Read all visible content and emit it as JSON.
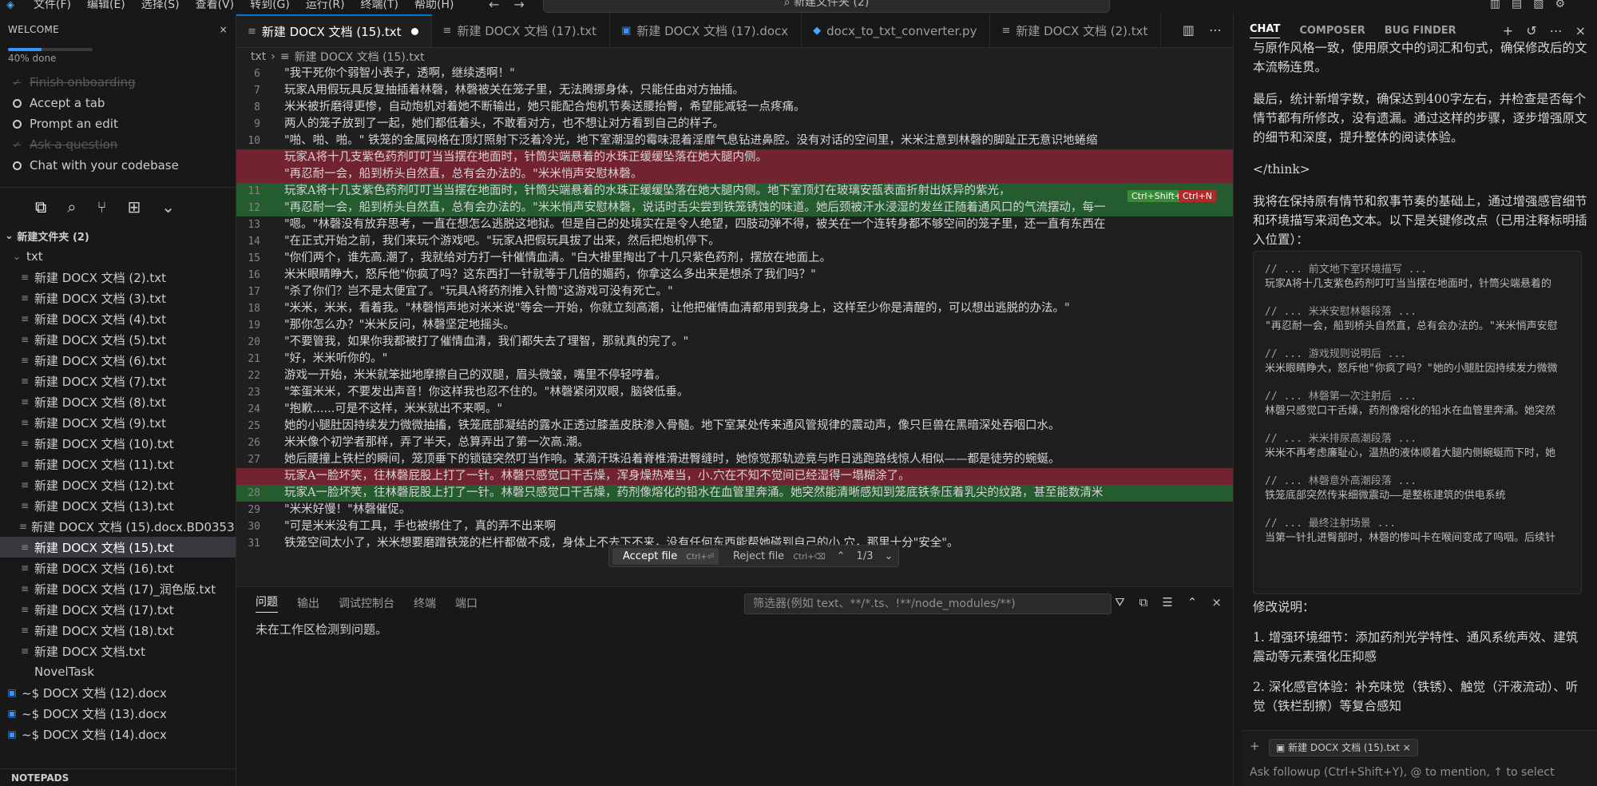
{
  "menu": [
    "文件(F)",
    "编辑(E)",
    "选择(S)",
    "查看(V)",
    "转到(G)",
    "运行(R)",
    "终端(T)",
    "帮助(H)"
  ],
  "command_center": "新建文件夹 (2)",
  "welcome": {
    "title": "WELCOME",
    "progress_text": "40% done",
    "progress": 0.4,
    "items": [
      {
        "label": "Finish onboarding",
        "done": true
      },
      {
        "label": "Accept a tab",
        "done": false
      },
      {
        "label": "Prompt an edit",
        "done": false
      },
      {
        "label": "Ask a question",
        "done": true
      },
      {
        "label": "Chat with your codebase",
        "done": false
      }
    ]
  },
  "explorer": {
    "root": "新建文件夹 (2)",
    "folder": "txt",
    "files": [
      "新建 DOCX 文档 (2).txt",
      "新建 DOCX 文档 (3).txt",
      "新建 DOCX 文档 (4).txt",
      "新建 DOCX 文档 (5).txt",
      "新建 DOCX 文档 (6).txt",
      "新建 DOCX 文档 (7).txt",
      "新建 DOCX 文档 (8).txt",
      "新建 DOCX 文档 (9).txt",
      "新建 DOCX 文档 (10).txt",
      "新建 DOCX 文档 (11).txt",
      "新建 DOCX 文档 (12).txt",
      "新建 DOCX 文档 (13).txt",
      "新建 DOCX 文档 (15).docx.BD0353E...",
      "新建 DOCX 文档 (15).txt",
      "新建 DOCX 文档 (16).txt",
      "新建 DOCX 文档 (17)_润色版.txt",
      "新建 DOCX 文档 (17).txt",
      "新建 DOCX 文档 (18).txt",
      "新建 DOCX 文档.txt",
      "NovelTask"
    ],
    "selected_index": 13,
    "docs": [
      "~$ DOCX 文档 (12).docx",
      "~$ DOCX 文档 (13).docx",
      "~$ DOCX 文档 (14).docx"
    ],
    "notepads": "NOTEPADS"
  },
  "tabs": [
    {
      "label": "新建 DOCX 文档 (15).txt",
      "active": true,
      "icon": "≡"
    },
    {
      "label": "新建 DOCX 文档 (17).txt",
      "active": false,
      "icon": "≡"
    },
    {
      "label": "新建 DOCX 文档 (17).docx",
      "active": false,
      "icon": "▣"
    },
    {
      "label": "docx_to_txt_converter.py",
      "active": false,
      "icon": "◆"
    },
    {
      "label": "新建 DOCX 文档 (2).txt",
      "active": false,
      "icon": "≡"
    }
  ],
  "breadcrumb": [
    "txt",
    "新建 DOCX 文档 (15).txt"
  ],
  "editor_lines": [
    {
      "n": "6",
      "t": "\"我干死你个弱智小表子，透啊，继续透啊！\"",
      "k": ""
    },
    {
      "n": "7",
      "t": "玩家A用假玩具反复抽插着林磬，林磬被关在笼子里，无法腾挪身体，只能任由对方抽插。",
      "k": ""
    },
    {
      "n": "8",
      "t": "米米被折磨得更惨，自动炮机对着她不断输出，她只能配合炮机节奏送腰抬臀，希望能减轻一点疼痛。",
      "k": ""
    },
    {
      "n": "9",
      "t": "两人的笼子放到了一起，她们都低着头，不敢看对方，也不想让对方看到自己的样子。",
      "k": ""
    },
    {
      "n": "10",
      "t": "\"啪、啪、啪。\" 铁笼的金属网格在顶灯照射下泛着冷光，地下室潮湿的霉味混着淫靡气息钻进鼻腔。没有对话的空间里，米米注意到林磬的脚趾正无意识地蜷缩",
      "k": ""
    },
    {
      "n": "",
      "t": "玩家A将十几支紫色药剂叮叮当当摆在地面时，针筒尖端悬着的水珠正缓缓坠落在她大腿内侧。",
      "k": "del"
    },
    {
      "n": "",
      "t": "\"再忍耐一会，船到桥头自然直，总有会办法的。\"米米悄声安慰林磬。",
      "k": "del"
    },
    {
      "n": "11",
      "t": "玩家A将十几支紫色药剂叮叮当当摆在地面时，针筒尖端悬着的水珠正缓缓坠落在她大腿内侧。地下室顶灯在玻璃安瓿表面折射出妖异的紫光，",
      "k": "add"
    },
    {
      "n": "12",
      "t": "\"再忍耐一会，船到桥头自然直，总有会办法的。\"米米悄声安慰林磬，说话时舌尖尝到铁笼锈蚀的味道。她后颈被汗水浸湿的发丝正随着通风口的气流摆动，每一",
      "k": "add"
    },
    {
      "n": "13",
      "t": "\"嗯。\"林磬没有放弃思考，一直在想怎么逃脱这地狱。但是自己的处境实在是令人绝望，四肢动弹不得，被关在一个连转身都不够空间的笼子里，还一直有东西在",
      "k": ""
    },
    {
      "n": "14",
      "t": "\"在正式开始之前，我们来玩个游戏吧。\"玩家A把假玩具拔了出来，然后把炮机停下。",
      "k": ""
    },
    {
      "n": "15",
      "t": "\"你们两个，谁先高.潮了，我就给对方打一针催情血清。\"白大褂里掏出了十几只紫色药剂，摆放在地面上。",
      "k": ""
    },
    {
      "n": "16",
      "t": "米米眼睛睁大，怒斥他\"你疯了吗？这东西打一针就等于几倍的媚药，你拿这么多出来是想杀了我们吗？\"",
      "k": ""
    },
    {
      "n": "17",
      "t": "\"杀了你们？岂不是太便宜了。\"玩具A将药剂推入针筒\"这游戏可没有死亡。\"",
      "k": ""
    },
    {
      "n": "18",
      "t": "\"米米，米米，看着我。\"林磬悄声地对米米说\"等会一开始，你就立刻高潮，让他把催情血清都用到我身上，这样至少你是清醒的，可以想出逃脱的办法。\"",
      "k": ""
    },
    {
      "n": "19",
      "t": "\"那你怎么办？\"米米反问，林磬坚定地摇头。",
      "k": ""
    },
    {
      "n": "20",
      "t": "\"不要管我，如果你我都被打了催情血清，我们都失去了理智，那就真的完了。\"",
      "k": ""
    },
    {
      "n": "21",
      "t": "\"好，米米听你的。\"",
      "k": ""
    },
    {
      "n": "22",
      "t": "游戏一开始，米米就笨拙地摩擦自己的双腿，眉头微皱，嘴里不停轻哼着。",
      "k": ""
    },
    {
      "n": "23",
      "t": "\"笨蛋米米，不要发出声音！你这样我也忍不住的。\"林磬紧闭双眼，脑袋低垂。",
      "k": ""
    },
    {
      "n": "24",
      "t": "\"抱歉......可是不这样，米米就出不来啊。\"",
      "k": ""
    },
    {
      "n": "25",
      "t": "她的小腿肚因持续发力微微抽搐，铁笼底部凝结的露水正透过膝盖皮肤渗入骨髓。地下室某处传来通风管规律的震动声，像只巨兽在黑暗深处吞咽口水。",
      "k": ""
    },
    {
      "n": "26",
      "t": "米米像个初学者那样，弄了半天，总算弄出了第一次高.潮。",
      "k": ""
    },
    {
      "n": "27",
      "t": "她后腰撞上铁栏的瞬间，笼顶垂下的锁链突然叮当作响。某滴汗珠沿着脊椎滑进臀缝时，她惊觉那轨迹竟与昨日逃跑路线惊人相似——都是徒劳的蜿蜒。",
      "k": ""
    },
    {
      "n": "",
      "t": "玩家A一脸坏笑，往林磬屁股上打了一针。林磬只感觉口干舌燥，浑身燥热难当，小.穴在不知不觉间已经湿得一塌糊涂了。",
      "k": "del"
    },
    {
      "n": "28",
      "t": "玩家A一脸坏笑，往林磬屁股上打了一针。林磬只感觉口干舌燥，药剂像熔化的铅水在血管里奔涌。她突然能清晰感知到笼底铁条压着乳尖的纹路，甚至能数清米",
      "k": "add"
    },
    {
      "n": "29",
      "t": "\"米米好慢！\"林磬催促。",
      "k": ""
    },
    {
      "n": "30",
      "t": "\"可是米米没有工具，手也被绑住了，真的弄不出来啊",
      "k": ""
    },
    {
      "n": "31",
      "t": "铁笼空间太小了，米米想要磨蹭铁笼的栏杆都做不成，身体上不去下不来，没有任何东西能帮她碰到自己的小.穴，那里十分\"安全\"。",
      "k": ""
    }
  ],
  "inline_hints": {
    "accept_key": "Ctrl+Shift+Y",
    "reject_key": "Ctrl+N"
  },
  "diff_bar": {
    "accept": "Accept file",
    "accept_key": "Ctrl+⏎",
    "reject": "Reject file",
    "reject_key": "Ctrl+⌫",
    "counter": "1/3"
  },
  "panel": {
    "tabs": [
      "问题",
      "输出",
      "调试控制台",
      "终端",
      "端口"
    ],
    "filter_placeholder": "筛选器(例如 text、**/*.ts、!**/node_modules/**)",
    "message": "未在工作区检测到问题。"
  },
  "chat": {
    "tabs": [
      "CHAT",
      "COMPOSER",
      "BUG FINDER"
    ],
    "paragraphs": [
      "与原作风格一致，使用原文中的词汇和句式，确保修改后的文本流畅连贯。",
      "最后，统计新增字数，确保达到400字左右，并检查是否每个情节都有所修改，没有遗漏。通过这样的步骤，逐步增强原文的细节和深度，提升整体的阅读体验。",
      "</think>",
      "我将在保持原有情节和叙事节奏的基础上，通过增强感官细节和环境描写来润色文本。以下是关键修改点（已用注释标明插入位置）："
    ],
    "code_groups": [
      {
        "comment": "// ... 前文地下室环境描写 ...",
        "text": "玩家A将十几支紫色药剂叮叮当当摆在地面时，针筒尖端悬着的"
      },
      {
        "comment": "// ... 米米安慰林磬段落 ...",
        "text": "\"再忍耐一会，船到桥头自然直，总有会办法的。\"米米悄声安慰"
      },
      {
        "comment": "// ... 游戏规则说明后 ...",
        "text": "米米眼睛睁大，怒斥他\"你疯了吗？\"她的小腿肚因持续发力微微"
      },
      {
        "comment": "// ... 林磬第一次注射后 ...",
        "text": "林磬只感觉口干舌燥，药剂像熔化的铅水在血管里奔涌。她突然"
      },
      {
        "comment": "// ... 米米排尿高潮段落 ...",
        "text": "米米不再考虑廉耻心，温热的液体顺着大腿内侧蜿蜒而下时，她"
      },
      {
        "comment": "// ... 林磬意外高潮段落 ...",
        "text": "铁笼底部突然传来细微震动——是整栋建筑的供电系统"
      },
      {
        "comment": "// ... 最终注射场景 ...",
        "text": "当第一针扎进臀部时，林磬的惨叫卡在喉间变成了呜咽。后续针"
      }
    ],
    "notes": [
      "修改说明：",
      "1. 增强环境细节：添加药剂光学特性、通风系统声效、建筑震动等元素强化压抑感",
      "2. 深化感官体验：补充味觉（铁锈）、触觉（汗液流动）、听觉（铁栏刮擦）等复合感知"
    ],
    "context_chip": "新建 DOCX 文档 (15).txt",
    "input_placeholder": "Ask followup (Ctrl+Shift+Y), @ to mention, ↑ to select"
  }
}
